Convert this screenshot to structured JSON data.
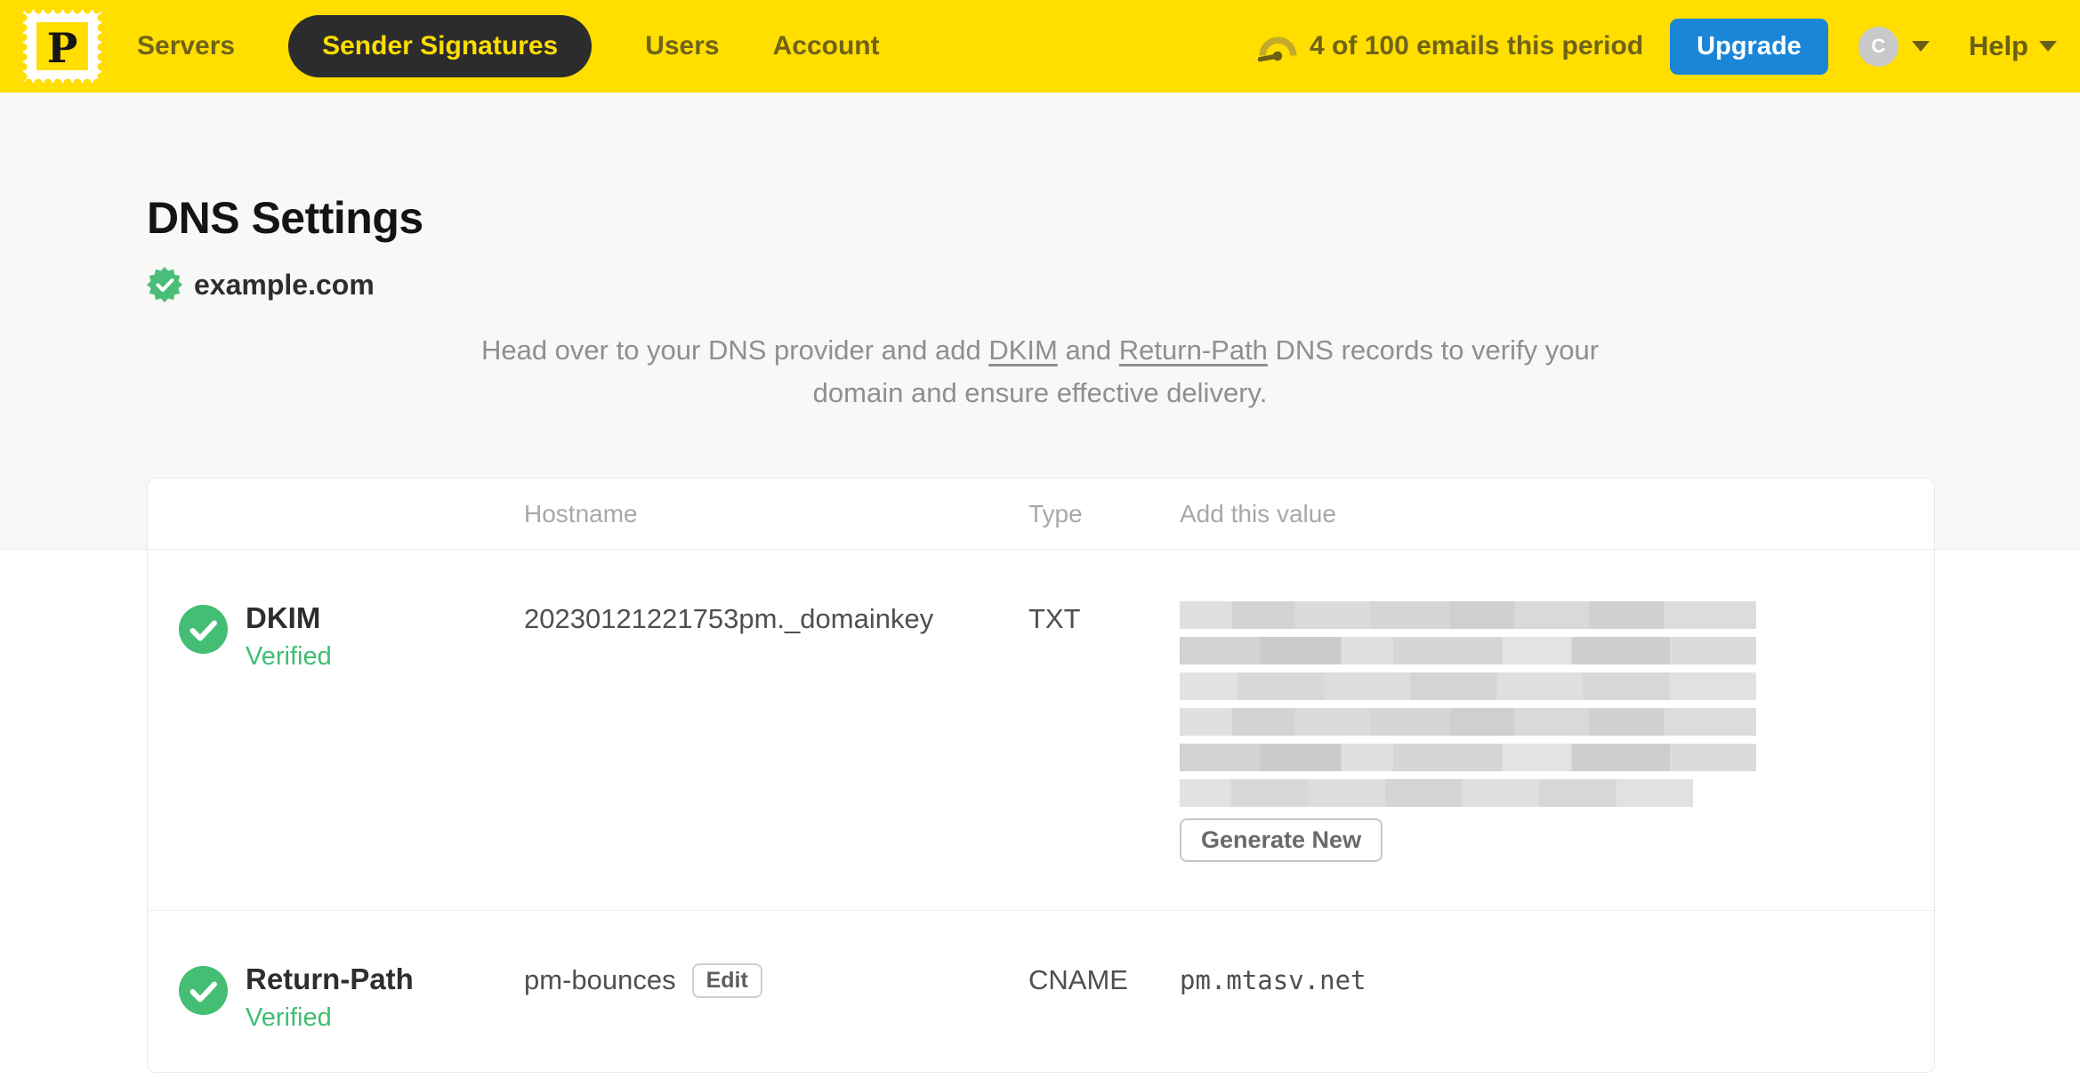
{
  "navbar": {
    "logo_letter": "P",
    "items": [
      {
        "label": "Servers",
        "active": false
      },
      {
        "label": "Sender Signatures",
        "active": true
      },
      {
        "label": "Users",
        "active": false
      },
      {
        "label": "Account",
        "active": false
      }
    ],
    "usage_text": "4 of 100 emails this period",
    "upgrade_label": "Upgrade",
    "avatar_initial": "C",
    "help_label": "Help"
  },
  "page": {
    "title": "DNS Settings",
    "domain": "example.com",
    "description": {
      "before_dkim": "Head over to your DNS provider and add ",
      "dkim_link": "DKIM",
      "and_text": " and ",
      "return_path_link": "Return-Path",
      "after": " DNS records to verify your domain and ensure effective delivery."
    }
  },
  "table": {
    "headers": [
      "Hostname",
      "Type",
      "Add this value"
    ],
    "rows": [
      {
        "name": "DKIM",
        "status": "Verified",
        "hostname": "20230121221753pm._domainkey",
        "type": "TXT",
        "value": "[redacted DKIM key]",
        "action_label": "Generate New"
      },
      {
        "name": "Return-Path",
        "status": "Verified",
        "hostname": "pm-bounces",
        "edit_label": "Edit",
        "type": "CNAME",
        "value": "pm.mtasv.net"
      }
    ]
  },
  "icons": {
    "logo": "postmark-stamp-icon",
    "usage": "gauge-icon",
    "domain_badge": "seal-check-icon",
    "row_status": "check-circle-icon",
    "dropdown": "chevron-down-icon"
  },
  "colors": {
    "brand_yellow": "#FFDE00",
    "nav_text": "#6F6316",
    "active_pill_bg": "#2C2C2C",
    "upgrade_blue": "#1B86D8",
    "success_green": "#43BE74",
    "muted_text": "#8F8F8F",
    "page_bg_upper": "#F8F8F7"
  }
}
